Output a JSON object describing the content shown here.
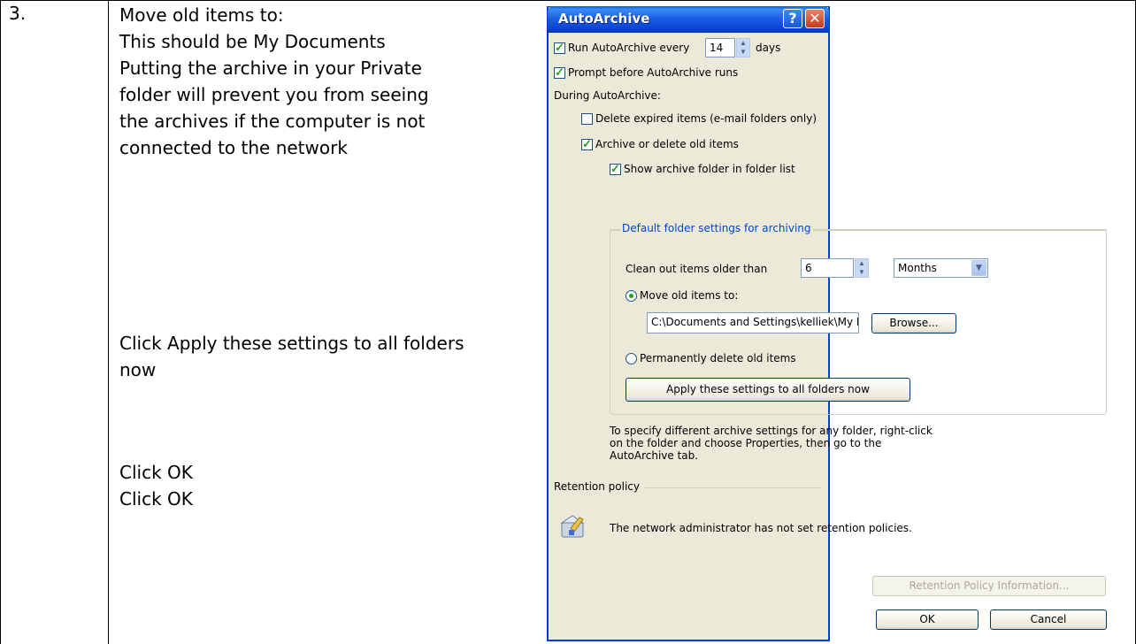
{
  "document": {
    "step_number": "3.",
    "instructions_block1": [
      "Move old items to:",
      "This should be My Documents",
      "Putting the archive in your Private",
      "folder will prevent you from seeing",
      "the archives if the computer is not",
      "connected to the network"
    ],
    "instructions_block2": [
      "Click Apply these settings to all folders",
      "now"
    ],
    "instructions_block3": [
      "Click OK",
      "Click OK"
    ]
  },
  "dialog": {
    "title": "AutoArchive",
    "help_glyph": "?",
    "close_glyph": "✕",
    "run_autoarchive": {
      "label_before": "Run AutoArchive every",
      "value": "14",
      "label_after": "days",
      "checked": true
    },
    "prompt_before": {
      "label": "Prompt before AutoArchive runs",
      "checked": true
    },
    "during_label": "During AutoArchive:",
    "delete_expired": {
      "label": "Delete expired items (e-mail folders only)",
      "checked": false
    },
    "archive_old": {
      "label": "Archive or delete old items",
      "checked": true
    },
    "show_folder": {
      "label": "Show archive folder in folder list",
      "checked": true
    },
    "group_title": "Default folder settings for archiving",
    "clean_out": {
      "label": "Clean out items older than",
      "value": "6",
      "unit": "Months"
    },
    "move_radio": {
      "label": "Move old items to:",
      "selected": true
    },
    "path": "C:\\Documents and Settings\\kelliek\\My Documents",
    "browse_label": "Browse...",
    "delete_radio": {
      "label": "Permanently delete old items",
      "selected": false
    },
    "apply_label": "Apply these settings to all folders now",
    "hint_lines": [
      "To specify different archive settings for any folder, right-click",
      "on the folder and choose Properties, then go to the",
      "AutoArchive tab."
    ],
    "retention_title": "Retention policy",
    "retention_text": "The network administrator has not set retention policies.",
    "retention_info_label": "Retention Policy Information...",
    "ok_label": "OK",
    "cancel_label": "Cancel"
  },
  "colors": {
    "titlebar": "#0a5ae0",
    "group_title": "#0046d5",
    "check": "#21a121"
  }
}
